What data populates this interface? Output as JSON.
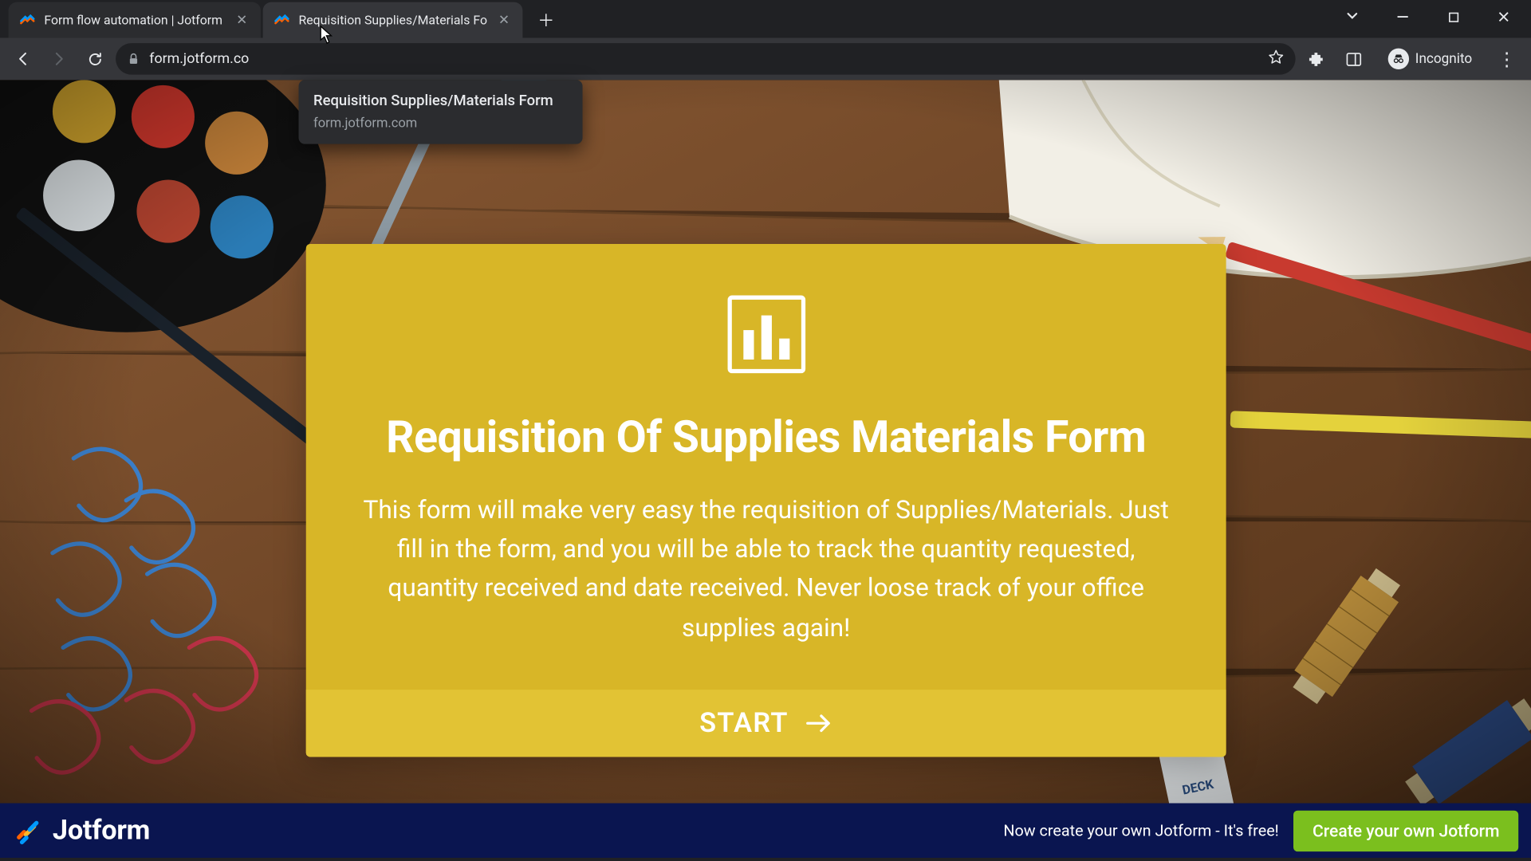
{
  "browser": {
    "tabs": [
      {
        "title": "Form flow automation | Jotform",
        "active": false
      },
      {
        "title": "Requisition Supplies/Materials Fo",
        "active": true
      }
    ],
    "url_display": "form.jotform.co",
    "incognito_label": "Incognito",
    "tooltip": {
      "title": "Requisition Supplies/Materials Form",
      "domain": "form.jotform.com"
    }
  },
  "card": {
    "title": "Requisition Of Supplies Materials Form",
    "description": "This form will make very easy the requisition of Supplies/Materials. Just fill in the form, and you will be able to track the quantity requested, quantity received and date received. Never loose track of your office supplies again!",
    "start_label": "START"
  },
  "bottom": {
    "brand": "Jotform",
    "message": "Now create your own Jotform - It's free!",
    "cta": "Create your own Jotform"
  }
}
